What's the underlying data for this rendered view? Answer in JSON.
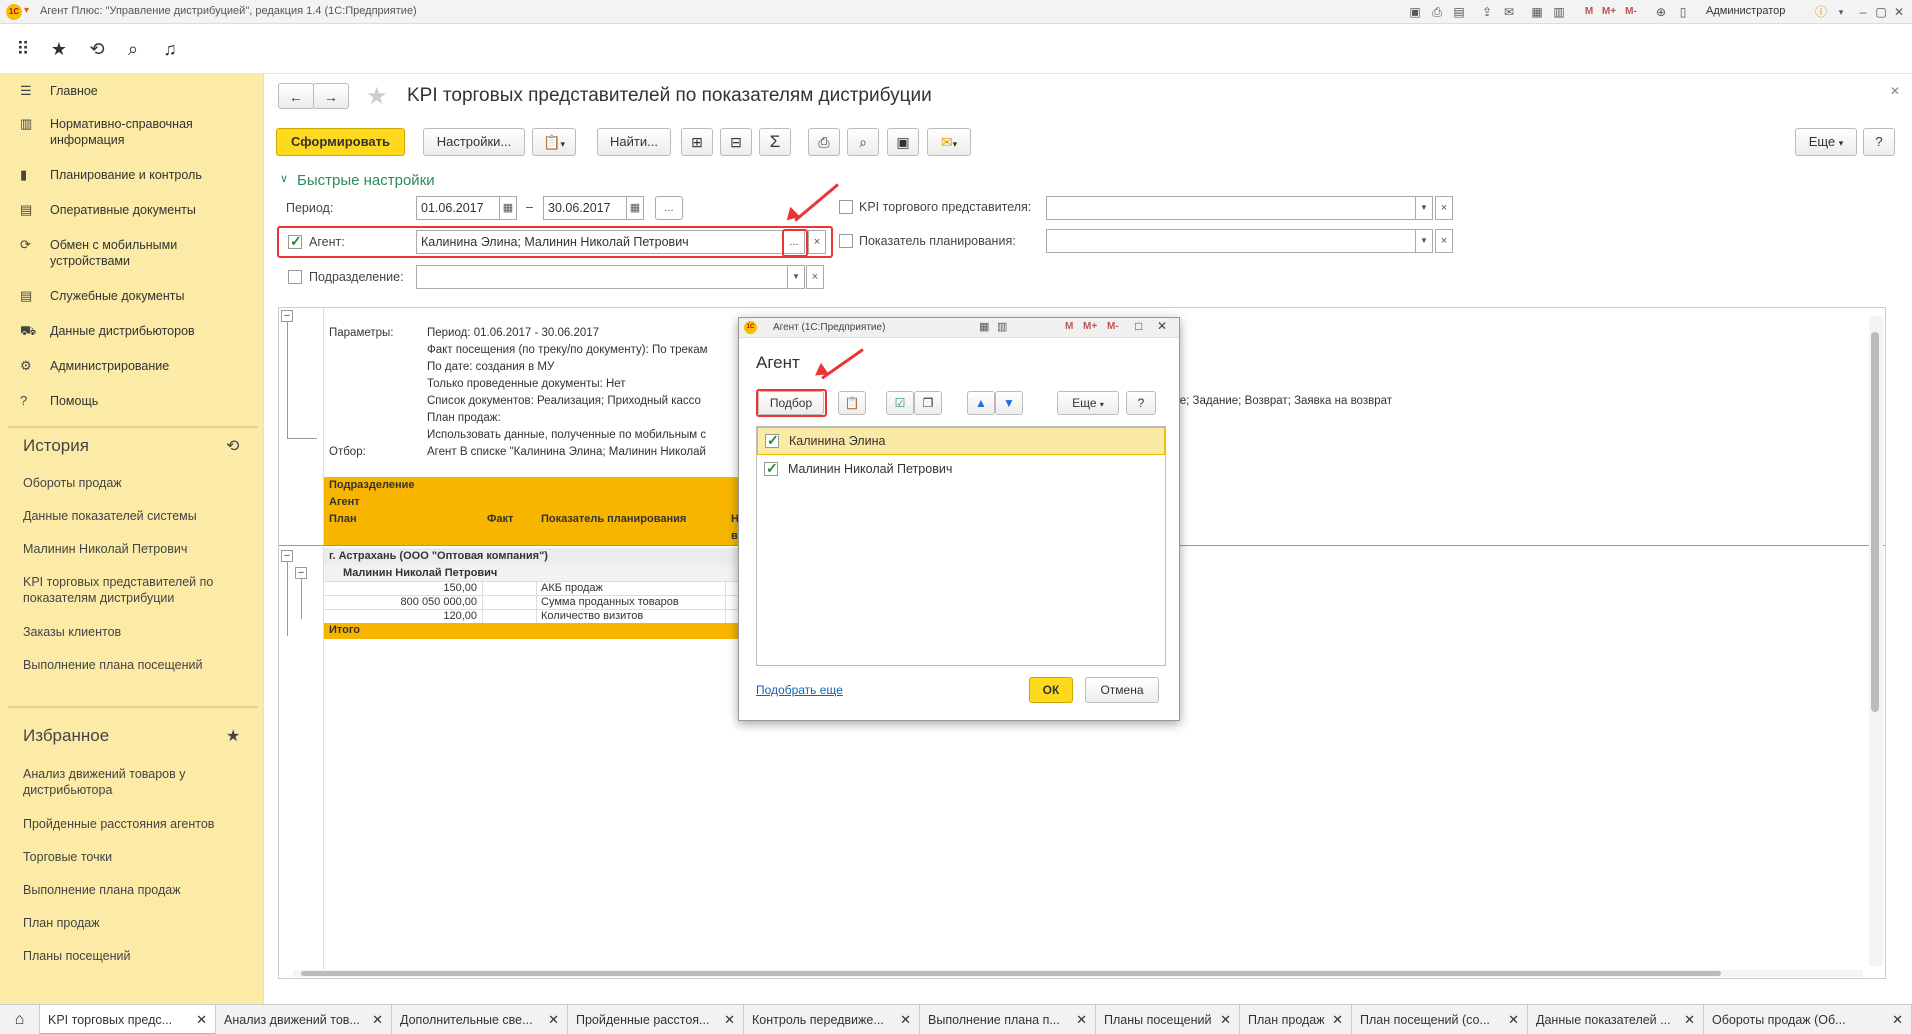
{
  "window": {
    "title": "Агент Плюс: \"Управление дистрибуцией\", редакция 1.4  (1С:Предприятие)",
    "user": "Администратор"
  },
  "sidebar": {
    "items": [
      {
        "icon": "menu-icon",
        "label": "Главное"
      },
      {
        "icon": "reference-icon",
        "label": "Нормативно-справочная информация"
      },
      {
        "icon": "chart-icon",
        "label": "Планирование и контроль"
      },
      {
        "icon": "documents-icon",
        "label": "Оперативные документы"
      },
      {
        "icon": "exchange-icon",
        "label": "Обмен с мобильными устройствами"
      },
      {
        "icon": "service-docs-icon",
        "label": "Служебные документы"
      },
      {
        "icon": "distributor-icon",
        "label": "Данные дистрибьюторов"
      },
      {
        "icon": "gear-icon",
        "label": "Администрирование"
      },
      {
        "icon": "help-icon",
        "label": "Помощь"
      }
    ],
    "history_title": "История",
    "history": [
      "Обороты продаж",
      "Данные показателей системы",
      "Малинин Николай Петрович",
      "KPI торговых представителей по показателям дистрибуции",
      "Заказы клиентов",
      "Выполнение плана посещений"
    ],
    "favorites_title": "Избранное",
    "favorites": [
      "Анализ движений товаров у дистрибьютора",
      "Пройденные расстояния агентов",
      "Торговые точки",
      "Выполнение плана продаж",
      "План продаж",
      "Планы посещений"
    ]
  },
  "header": {
    "title": "KPI торговых представителей по показателям дистрибуции"
  },
  "toolbar": {
    "generate": "Сформировать",
    "settings": "Настройки...",
    "find": "Найти...",
    "more": "Еще",
    "help": "?"
  },
  "quick": {
    "title": "Быстрые настройки",
    "period_label": "Период:",
    "date_from": "01.06.2017",
    "dash": "–",
    "date_to": "30.06.2017",
    "ellipsis": "...",
    "agent_label": "Агент:",
    "agent_value": "Калинина Элина; Малинин Николай Петрович",
    "division_label": "Подразделение:",
    "kpi_label": "KPI торгового представителя:",
    "indicator_label": "Показатель планирования:"
  },
  "report": {
    "params_label": "Параметры:",
    "params": [
      "Период: 01.06.2017 - 30.06.2017",
      "Факт посещения (по треку/по документу): По трекам",
      "По дате: создания в МУ",
      "Только проведенные документы: Нет",
      "Список документов: Реализация; Приходный кассо",
      "План продаж:",
      "Использовать данные, полученные по мобильным с"
    ],
    "params_tail": "ние; Задание; Возврат; Заявка на возврат",
    "filter_label": "Отбор:",
    "filter": "Агент В списке \"Калинина Элина; Малинин Николай",
    "head": {
      "division": "Подразделение",
      "agent": "Агент",
      "plan": "План",
      "fact": "Факт",
      "indicator": "Показатель планирования",
      "cut1": "Н",
      "cut2": "в"
    },
    "group": "г. Астрахань (ООО \"Оптовая компания\")",
    "agent_row": "Малинин Николай Петрович",
    "rows": [
      {
        "plan": "150,00",
        "indicator": "АКБ продаж"
      },
      {
        "plan": "800 050 000,00",
        "indicator": "Сумма проданных товаров"
      },
      {
        "plan": "120,00",
        "indicator": "Количество визитов"
      }
    ],
    "total": "Итого"
  },
  "dialog": {
    "window_title": "Агент  (1С:Предприятие)",
    "title": "Агент",
    "pick": "Подбор",
    "more": "Еще",
    "help": "?",
    "items": [
      {
        "name": "Калинина Элина",
        "checked": true
      },
      {
        "name": "Малинин Николай Петрович",
        "checked": true
      }
    ],
    "pick_more": "Подобрать еще",
    "ok": "ОК",
    "cancel": "Отмена"
  },
  "tabs": [
    "KPI торговых предс...",
    "Анализ движений тов...",
    "Дополнительные све...",
    "Пройденные расстоя...",
    "Контроль передвиже...",
    "Выполнение плана п...",
    "Планы посещений",
    "План продаж",
    "План посещений  (со...",
    "Данные показателей ...",
    "Обороты продаж (Об..."
  ],
  "colors": {
    "accent": "#f7b500",
    "sidebar": "#fbeba7",
    "highlight": "#e33333",
    "green": "#2e8b57"
  }
}
